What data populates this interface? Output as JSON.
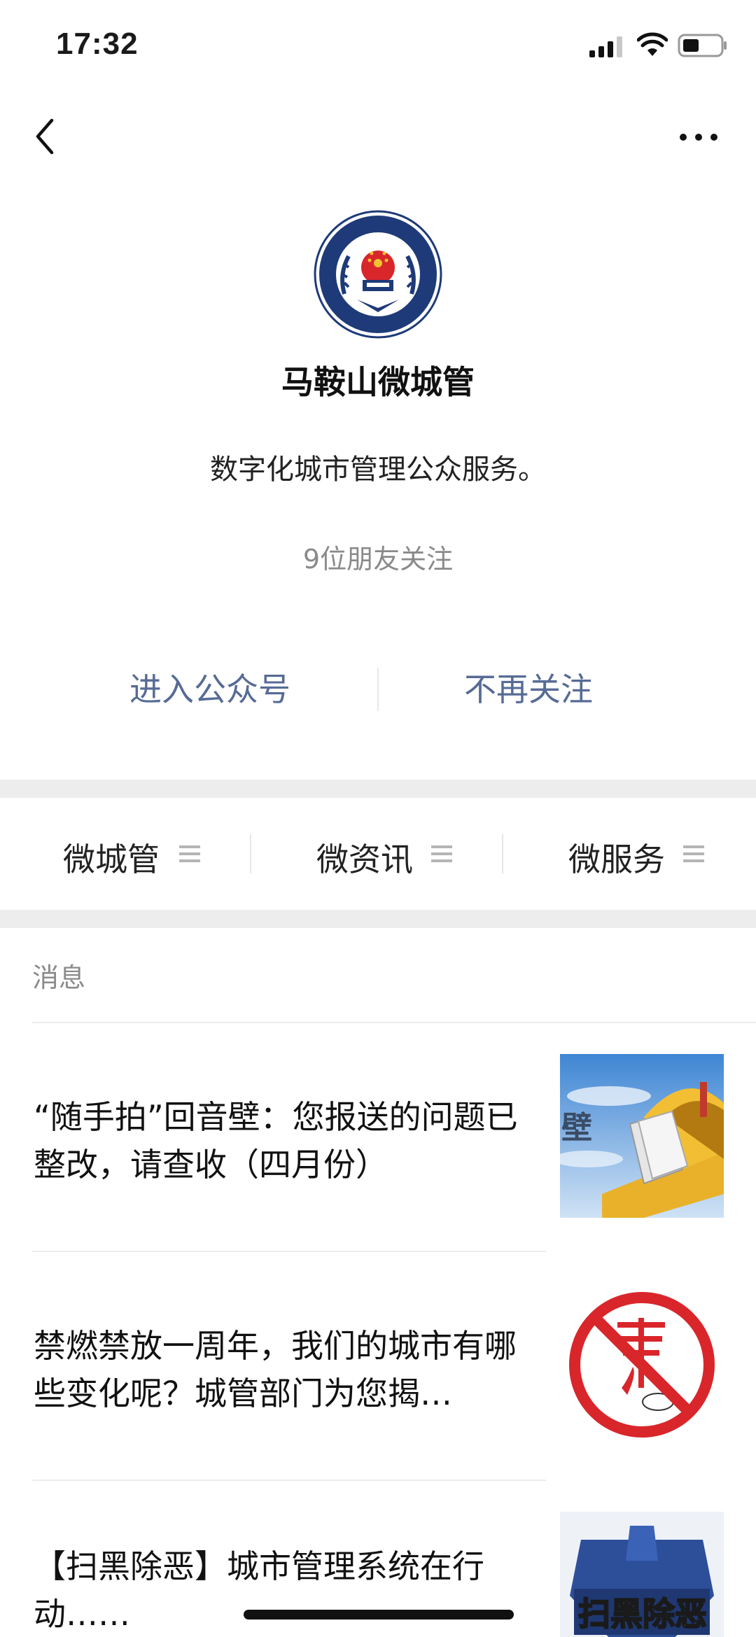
{
  "status_bar": {
    "time": "17:32",
    "icons": [
      "signal-icon",
      "wifi-icon",
      "battery-icon"
    ]
  },
  "nav": {
    "icons": [
      "back-icon",
      "more-icon"
    ]
  },
  "profile": {
    "name": "马鞍山微城管",
    "description": "数字化城市管理公众服务。",
    "friends_following": "9位朋友关注",
    "enter_label": "进入公众号",
    "unfollow_label": "不再关注",
    "avatar_icon": "city-management-emblem"
  },
  "menu": [
    {
      "label": "微城管"
    },
    {
      "label": "微资讯"
    },
    {
      "label": "微服务"
    }
  ],
  "messages": {
    "header": "消息",
    "items": [
      {
        "title": "“随手拍”回音壁：您报送的问题已整改，请查收（四月份）",
        "thumb_icon": "mailbox-image"
      },
      {
        "title": "禁燃禁放一周年，我们的城市有哪些变化呢？城管部门为您揭…",
        "thumb_icon": "no-firecrackers-image"
      },
      {
        "title": "【扫黑除恶】城市管理系统在行动……",
        "thumb_icon": "anti-crime-image",
        "thumb_text": "扫黑除恶"
      }
    ]
  },
  "colors": {
    "link": "#576b95",
    "divider_band": "#ededed",
    "secondary_text": "#8a8a8a"
  }
}
